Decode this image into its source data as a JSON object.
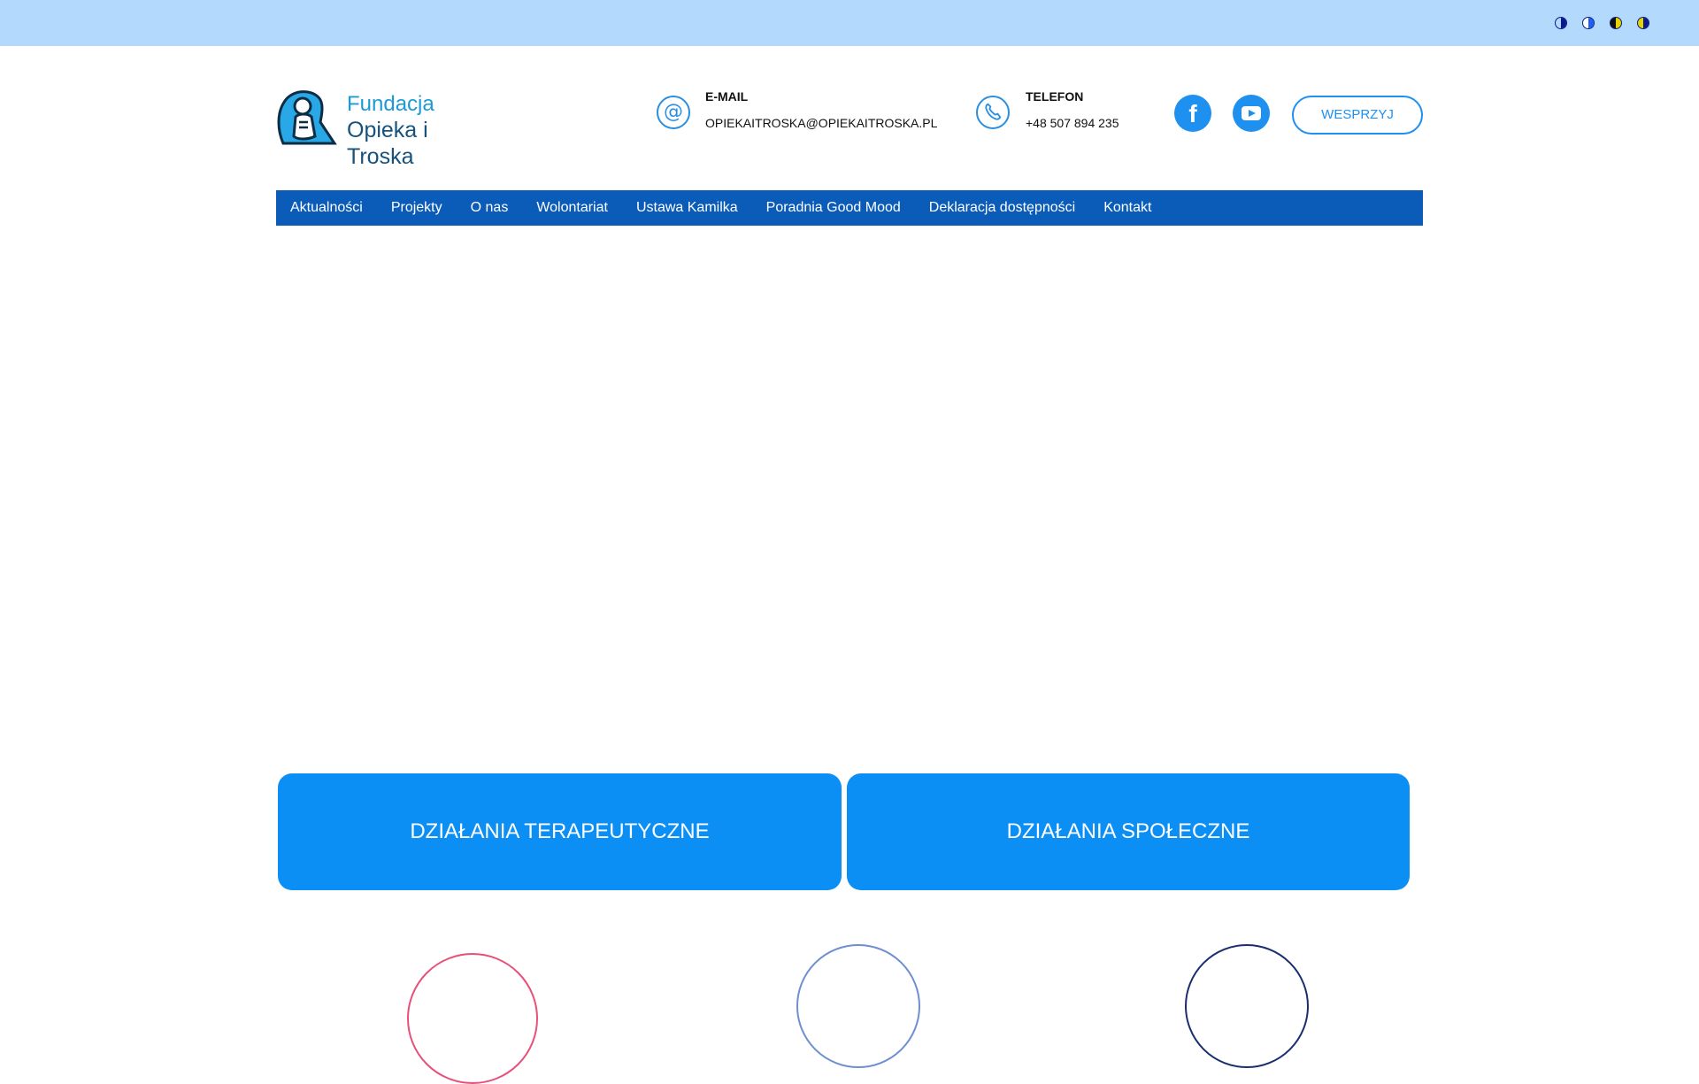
{
  "accessibility": {
    "contrast_options": [
      {
        "name": "contrast-default-icon",
        "color": "#0a1a8c"
      },
      {
        "name": "contrast-blue-icon",
        "color": "#1e5ef0"
      },
      {
        "name": "contrast-yellow-icon",
        "color": "#e6d400"
      },
      {
        "name": "contrast-navy-icon",
        "color": "#0a1a8c"
      }
    ]
  },
  "header": {
    "logo": {
      "line1": "Fundacja",
      "line2": "Opieka i Troska"
    },
    "email": {
      "label": "E-MAIL",
      "value": "OPIEKAITROSKA@OPIEKAITROSKA.PL",
      "icon": "at-icon"
    },
    "phone": {
      "label": "TELEFON",
      "value": "+48 507 894 235",
      "icon": "phone-icon"
    },
    "social": {
      "facebook": "facebook-icon",
      "youtube": "youtube-icon"
    },
    "support_button": "WESPRZYJ"
  },
  "nav": {
    "items": [
      "Aktualności",
      "Projekty",
      "O nas",
      "Wolontariat",
      "Ustawa Kamilka",
      "Poradnia Good Mood",
      "Deklaracja dostępności",
      "Kontakt"
    ],
    "color": "#0a5cb8"
  },
  "tiles": {
    "therapeutic": "DZIAŁANIA TERAPEUTYCZNE",
    "social": "DZIAŁANIA SPOŁECZNE",
    "color": "#0b8ff5"
  }
}
